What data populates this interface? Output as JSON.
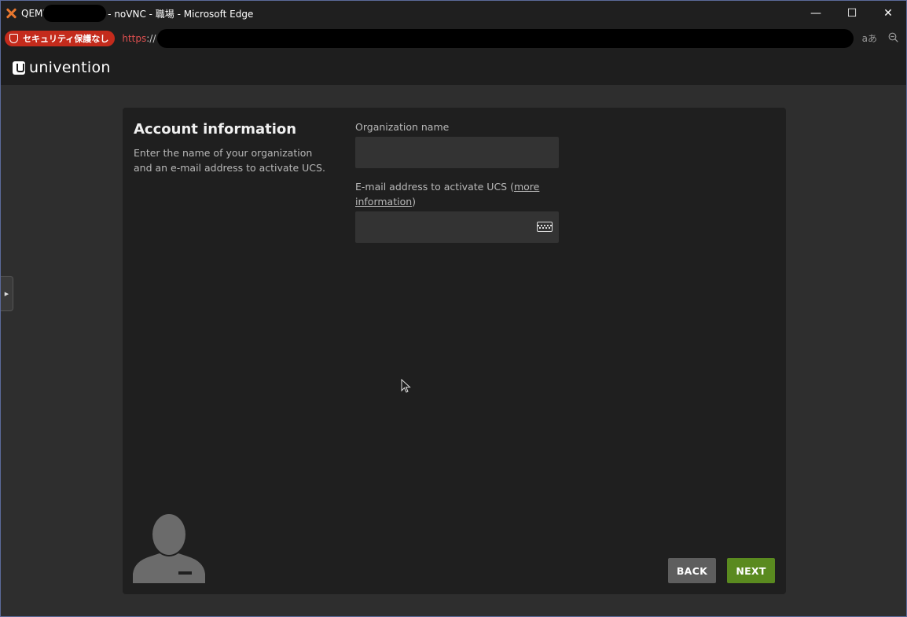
{
  "window": {
    "title_prefix": "QEMU",
    "title_suffix": "- noVNC - 職場 - Microsoft Edge",
    "controls": {
      "minimize": "—",
      "maximize": "☐",
      "close": "✕"
    }
  },
  "addressbar": {
    "security_label": "セキュリティ保護なし",
    "url_scheme": "https",
    "url_sep": "://",
    "translate_icon": "aあ",
    "zoom_icon": "zoom-out-icon"
  },
  "header": {
    "brand": "univention"
  },
  "form": {
    "title": "Account information",
    "description": "Enter the name of your organization and an e-mail address to activate UCS.",
    "org_label": "Organization name",
    "org_value": "",
    "email_label_prefix": "E-mail address to activate UCS (",
    "email_link": "more information",
    "email_label_suffix": ")",
    "email_value": ""
  },
  "buttons": {
    "back": "BACK",
    "next": "NEXT"
  },
  "colors": {
    "next_button": "#5a8a1f",
    "back_button": "#5e5e5e",
    "security_badge": "#c42b1c"
  }
}
